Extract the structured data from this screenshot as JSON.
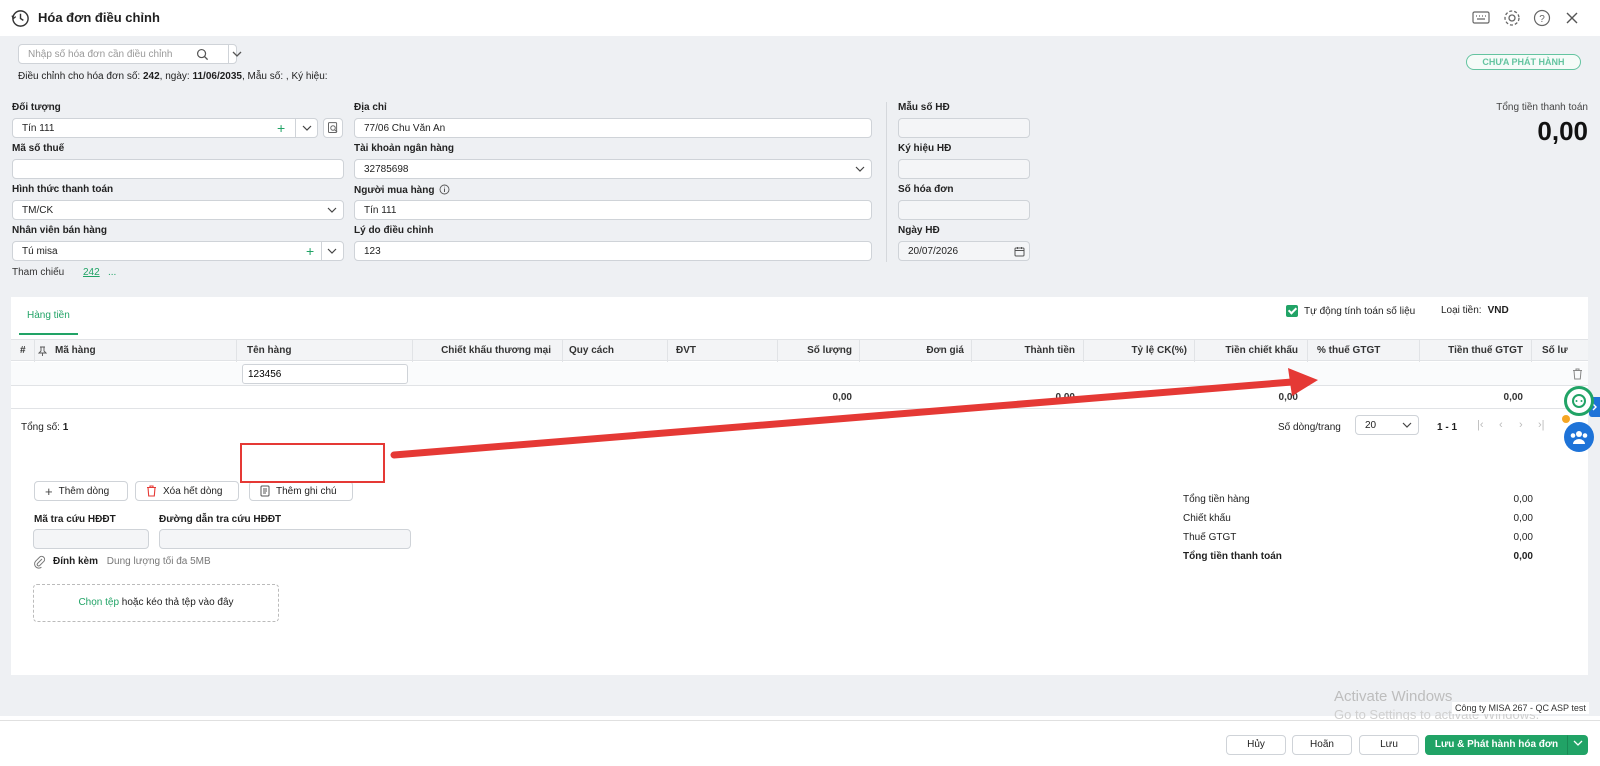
{
  "window": {
    "title": "Hóa đơn điều chỉnh"
  },
  "search": {
    "placeholder": "Nhập số hóa đơn cần điều chỉnh"
  },
  "adjust_info": {
    "prefix": "Điều chỉnh cho hóa đơn số:",
    "invoice_no": "242",
    "date_label": ", ngày:",
    "date": "11/06/2035",
    "suffix": ", Mẫu số: , Ký hiệu:"
  },
  "status_badge": "CHƯA PHÁT HÀNH",
  "form": {
    "doi_tuong": {
      "label": "Đối tượng",
      "value": "Tín 111"
    },
    "ma_so_thue": {
      "label": "Mã số thuế",
      "value": ""
    },
    "hinh_thuc_tt": {
      "label": "Hình thức thanh toán",
      "value": "TM/CK"
    },
    "nhan_vien": {
      "label": "Nhân viên bán hàng",
      "value": "Tú misa"
    },
    "dia_chi": {
      "label": "Địa chỉ",
      "value": "77/06 Chu Văn An"
    },
    "tai_khoan": {
      "label": "Tài khoản ngân hàng",
      "value": "32785698"
    },
    "nguoi_mua": {
      "label": "Người mua hàng",
      "value": "Tín 111"
    },
    "ly_do": {
      "label": "Lý do điều chỉnh",
      "value": "123"
    },
    "mau_so": {
      "label": "Mẫu số HĐ",
      "value": ""
    },
    "ky_hieu": {
      "label": "Ký hiệu HĐ",
      "value": ""
    },
    "so_hoa_don": {
      "label": "Số hóa đơn",
      "value": ""
    },
    "ngay_hd": {
      "label": "Ngày HĐ",
      "value": "20/07/2026"
    }
  },
  "total_top": {
    "label": "Tổng tiền thanh toán",
    "value": "0,00"
  },
  "reference": {
    "label": "Tham chiếu",
    "link": "242",
    "more": "..."
  },
  "tabs": [
    "Hàng tiền"
  ],
  "auto_calc_label": "Tự động tính toán số liệu",
  "currency": {
    "label": "Loại tiền:",
    "value": "VND"
  },
  "grid": {
    "headers": [
      "#",
      "Mã hàng",
      "Tên hàng",
      "Chiết khấu thương mại",
      "Quy cách",
      "ĐVT",
      "Số lượng",
      "Đơn giá",
      "Thành tiền",
      "Tỷ lệ CK(%)",
      "Tiền chiết khấu",
      "% thuế GTGT",
      "Tiền thuế GTGT",
      "Số lư"
    ],
    "row_ten_hang": "123456",
    "sums": {
      "so_luong": "0,00",
      "thanh_tien": "0,00",
      "tien_ck": "0,00",
      "tien_thue": "0,00"
    }
  },
  "pagination": {
    "total_label": "Tổng số:",
    "total": "1",
    "per_page_label": "Số dòng/trang",
    "per_page": "20",
    "range": "1 - 1"
  },
  "actions": {
    "add_row": "Thêm dòng",
    "delete_all": "Xóa hết dòng",
    "add_note": "Thêm ghi chú"
  },
  "lookup": {
    "code_label": "Mã tra cứu HĐĐT",
    "url_label": "Đường dẫn tra cứu HĐĐT"
  },
  "attach": {
    "label": "Đính kèm",
    "hint": "Dung lượng tối đa 5MB",
    "choose": "Chọn tệp",
    "drop_text": " hoặc kéo thả tệp vào đây"
  },
  "summary": [
    {
      "label": "Tổng tiền hàng",
      "value": "0,00"
    },
    {
      "label": "Chiết khấu",
      "value": "0,00"
    },
    {
      "label": "Thuế GTGT",
      "value": "0,00"
    },
    {
      "label": "Tổng tiền thanh toán",
      "value": "0,00"
    }
  ],
  "watermark": {
    "line1": "Activate Windows",
    "line2": "Go to Settings to activate Windows."
  },
  "company": "Công ty MISA 267 - QC ASP test",
  "footer": {
    "cancel": "Hủy",
    "undo": "Hoãn",
    "save": "Lưu",
    "save_publish": "Lưu & Phát hành hóa đơn"
  },
  "colors": {
    "accent": "#21a366",
    "annotation": "#e53935",
    "side_tab": "#1e73d8"
  }
}
